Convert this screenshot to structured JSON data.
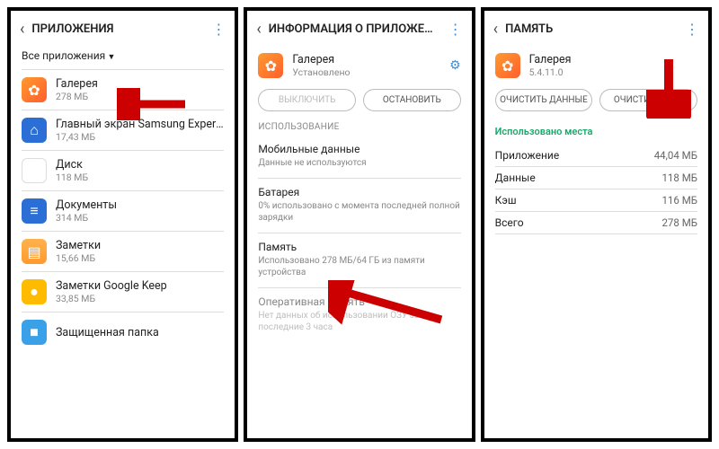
{
  "panel1": {
    "title": "ПРИЛОЖЕНИЯ",
    "filter": "Все приложения",
    "apps": [
      {
        "name": "Галерея",
        "size": "278 МБ",
        "icon": "ic-gallery",
        "glyph": "✿"
      },
      {
        "name": "Главный экран Samsung Experie..",
        "size": "17,43 МБ",
        "icon": "ic-home",
        "glyph": "⌂"
      },
      {
        "name": "Диск",
        "size": "118 МБ",
        "icon": "ic-drive",
        "glyph": "▲"
      },
      {
        "name": "Документы",
        "size": "314 МБ",
        "icon": "ic-docs",
        "glyph": "≡"
      },
      {
        "name": "Заметки",
        "size": "15,66 МБ",
        "icon": "ic-notes",
        "glyph": "▤"
      },
      {
        "name": "Заметки Google Keep",
        "size": "33,85 МБ",
        "icon": "ic-keep",
        "glyph": "●"
      },
      {
        "name": "Защищенная папка",
        "size": "",
        "icon": "ic-folder",
        "glyph": "■"
      }
    ]
  },
  "panel2": {
    "title": "ИНФОРМАЦИЯ О ПРИЛОЖЕНИИ",
    "app_name": "Галерея",
    "app_status": "Установлено",
    "btn_disable": "ВЫКЛЮЧИТЬ",
    "btn_stop": "ОСТАНОВИТЬ",
    "section_usage": "ИСПОЛЬЗОВАНИЕ",
    "mobile_data_title": "Мобильные данные",
    "mobile_data_sub": "Данные не используются",
    "battery_title": "Батарея",
    "battery_sub": "0% использовано с момента последней полной зарядки",
    "memory_title": "Память",
    "memory_sub": "Использовано 278 МБ/64 ГБ из памяти устройства",
    "ram_title": "Оперативная память",
    "ram_sub": "Нет данных об использовании ОЗУ за последние 3 часа"
  },
  "panel3": {
    "title": "ПАМЯТЬ",
    "app_name": "Галерея",
    "app_version": "5.4.11.0",
    "btn_clear_data": "ОЧИСТИТЬ ДАННЫЕ",
    "btn_clear_cache": "ОЧИСТИТЬ КЭШ",
    "usage_label": "Использовано места",
    "rows": [
      {
        "k": "Приложение",
        "v": "44,04 МБ"
      },
      {
        "k": "Данные",
        "v": "118 МБ"
      },
      {
        "k": "Кэш",
        "v": "116 МБ"
      },
      {
        "k": "Всего",
        "v": "278 МБ"
      }
    ]
  }
}
